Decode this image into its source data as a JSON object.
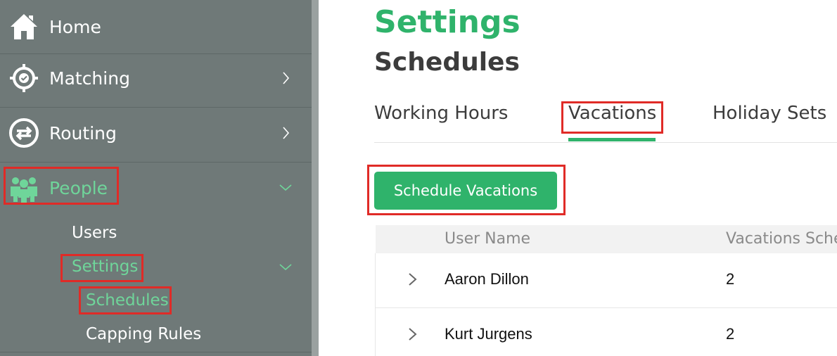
{
  "sidebar": {
    "items": [
      {
        "label": "Home",
        "icon": "home-icon"
      },
      {
        "label": "Matching",
        "icon": "target-icon"
      },
      {
        "label": "Routing",
        "icon": "routing-arrows-icon"
      },
      {
        "label": "People",
        "icon": "people-icon"
      }
    ],
    "people_sub": {
      "users": "Users",
      "settings": "Settings",
      "schedules": "Schedules",
      "capping_rules": "Capping Rules"
    }
  },
  "page": {
    "title": "Settings",
    "subtitle": "Schedules"
  },
  "tabs": [
    {
      "label": "Working Hours"
    },
    {
      "label": "Vacations"
    },
    {
      "label": "Holiday Sets"
    }
  ],
  "actions": {
    "schedule_button": "Schedule Vacations"
  },
  "table": {
    "columns": [
      "User Name",
      "Vacations Sche"
    ],
    "rows": [
      {
        "name": "Aaron Dillon",
        "count": "2"
      },
      {
        "name": "Kurt Jurgens",
        "count": "2"
      }
    ]
  },
  "colors": {
    "accent": "#2fb36b",
    "sidebar_bg": "#6f7978",
    "highlight_box": "#e02b27",
    "active_nav_text": "#6fd59a"
  }
}
